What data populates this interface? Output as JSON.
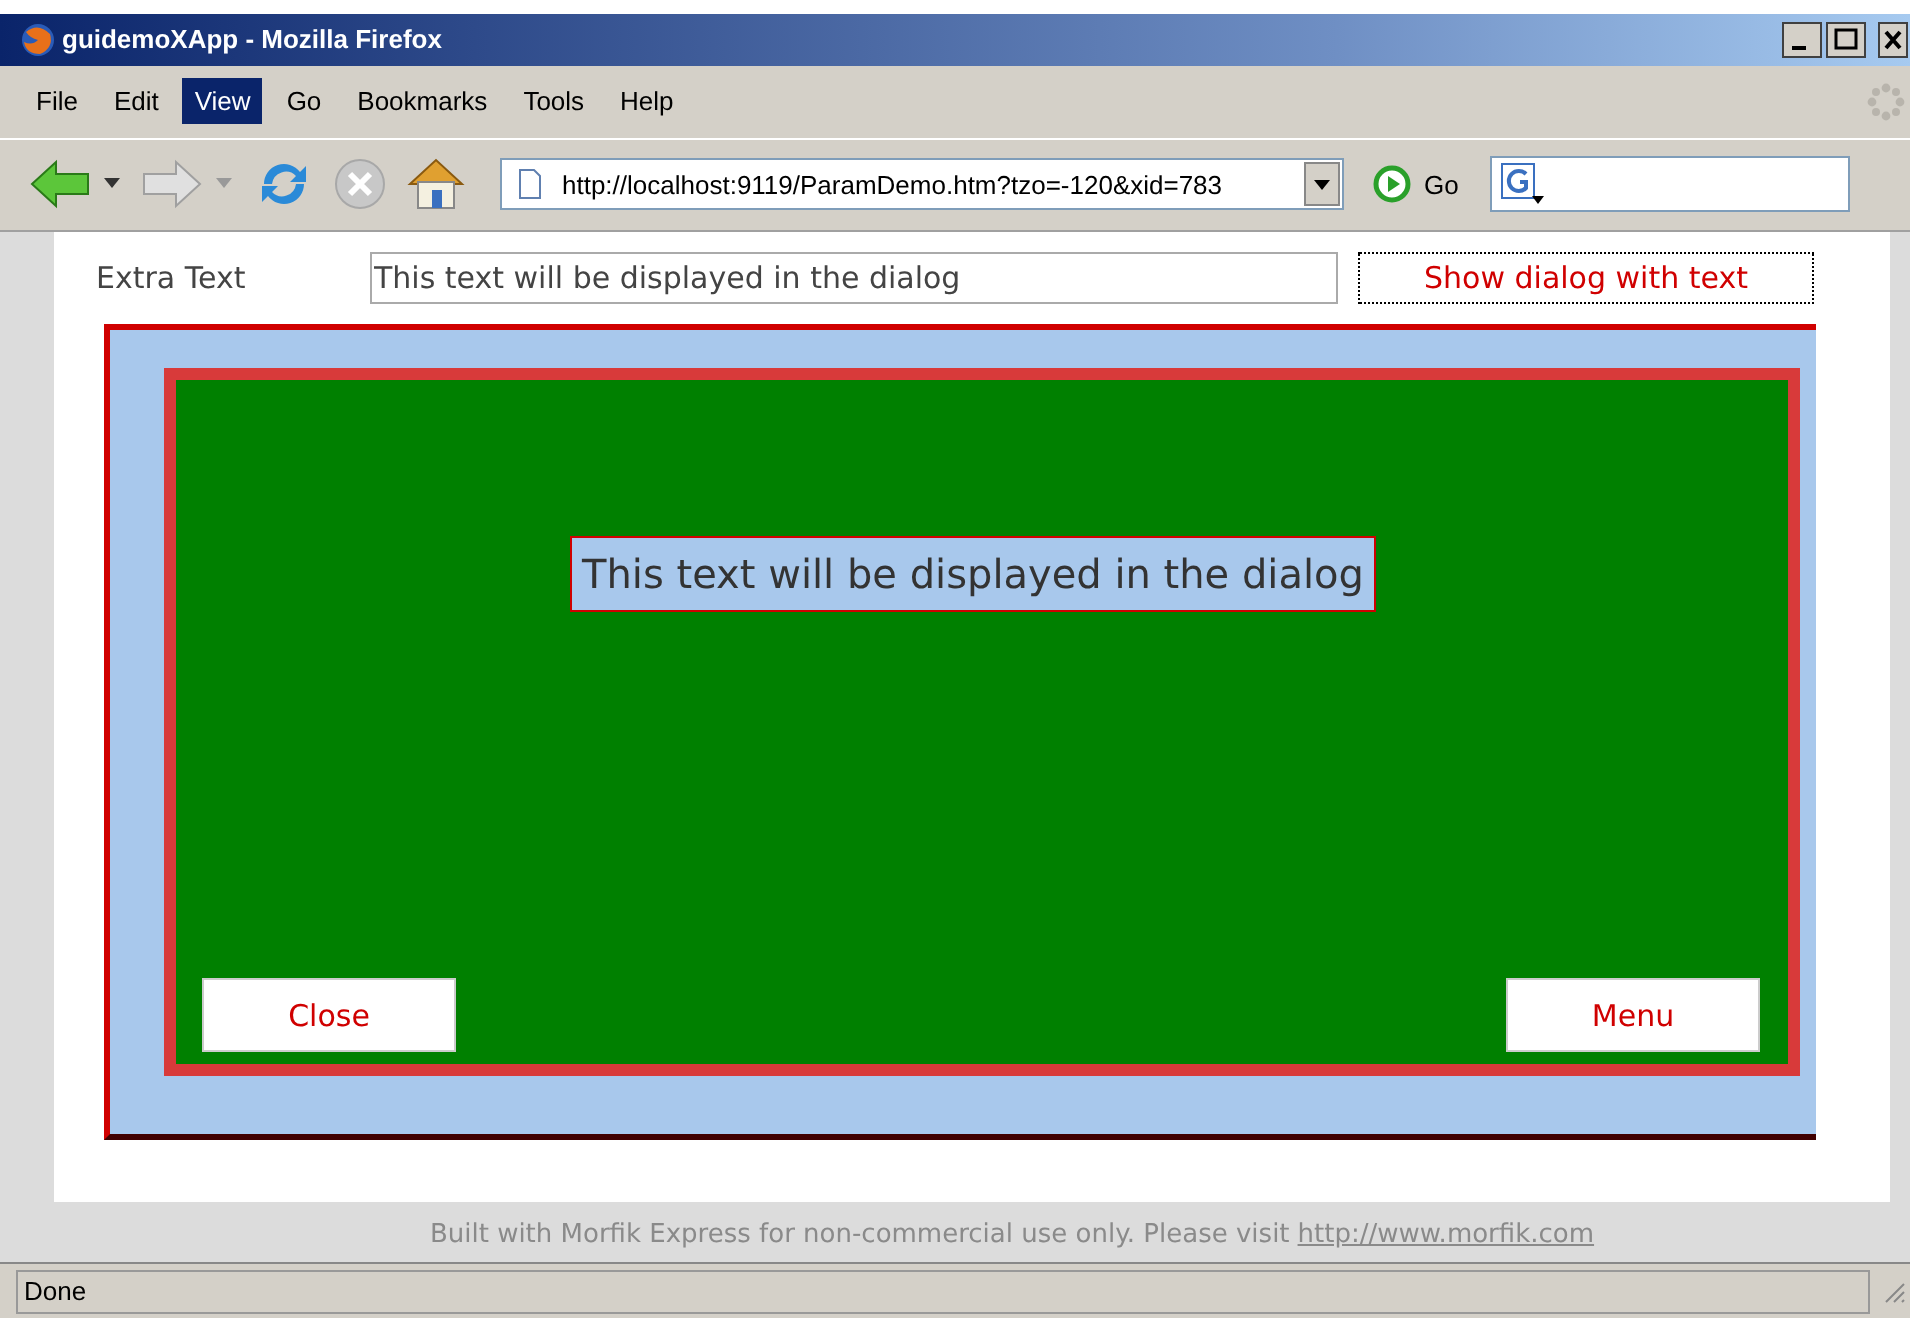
{
  "window": {
    "title": "guidemoXApp - Mozilla Firefox"
  },
  "menu": [
    {
      "label": "File",
      "selected": false
    },
    {
      "label": "Edit",
      "selected": false
    },
    {
      "label": "View",
      "selected": true
    },
    {
      "label": "Go",
      "selected": false
    },
    {
      "label": "Bookmarks",
      "selected": false
    },
    {
      "label": "Tools",
      "selected": false
    },
    {
      "label": "Help",
      "selected": false
    }
  ],
  "toolbar": {
    "address": "http://localhost:9119/ParamDemo.htm?tzo=-120&xid=783",
    "go": "Go"
  },
  "form": {
    "label": "Extra Text",
    "value": "This text will be displayed in the dialog",
    "button": "Show dialog with text"
  },
  "dialog": {
    "text": "This text will be displayed in the dialog",
    "buttons": [
      "Close",
      "Menu"
    ]
  },
  "footer": {
    "text": "Built with Morfik Express for non-commercial use only. Please visit",
    "link": "http://www.morfik.com"
  },
  "status_bar": {
    "text": "Done"
  }
}
